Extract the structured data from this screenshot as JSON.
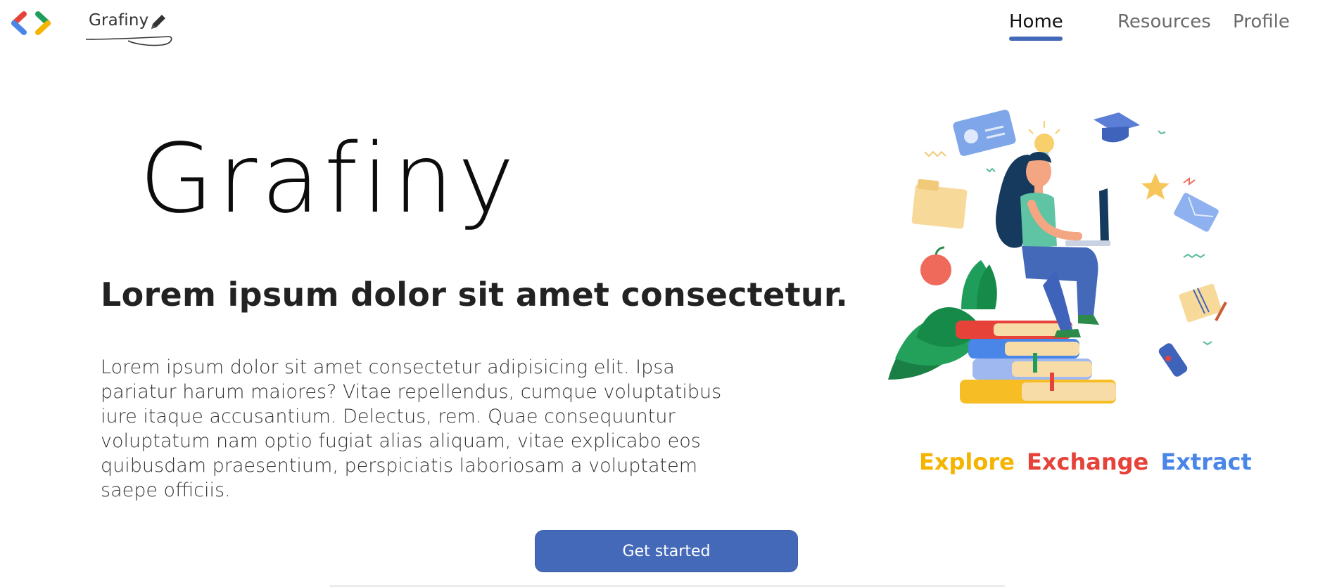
{
  "navbar": {
    "brand_name": "Grafiny",
    "links": [
      {
        "label": "Home",
        "active": true
      },
      {
        "label": "Resources",
        "active": false
      },
      {
        "label": "Profile",
        "active": false
      }
    ]
  },
  "hero": {
    "title": "Grafiny",
    "subtitle": "Lorem ipsum dolor sit amet consectetur.",
    "body": "Lorem ipsum dolor sit amet consectetur adipisicing elit. Ipsa pariatur harum maiores? Vitae repellendus, cumque voluptatibus iure itaque accusantium. Delectus, rem. Quae consequuntur voluptatum nam optio fugiat alias aliquam, vitae explicabo eos quibusdam praesentium, perspiciatis laboriosam a voluptatem saepe officiis.",
    "cta_label": "Get started"
  },
  "tagline": {
    "words": [
      "Explore",
      "Exchange",
      "Extract"
    ],
    "colors": [
      "#f5b400",
      "#e6423a",
      "#4a86e8"
    ]
  },
  "theme": {
    "accent": "#4469b9",
    "logo_left_colors": [
      "#e6423a",
      "#4a86e8"
    ],
    "logo_right_colors": [
      "#f5b400",
      "#1e9e5a"
    ]
  },
  "icons": {
    "logo": "code-chevrons-icon",
    "pencil": "pencil-icon",
    "illustration": "student-on-books-illustration"
  }
}
